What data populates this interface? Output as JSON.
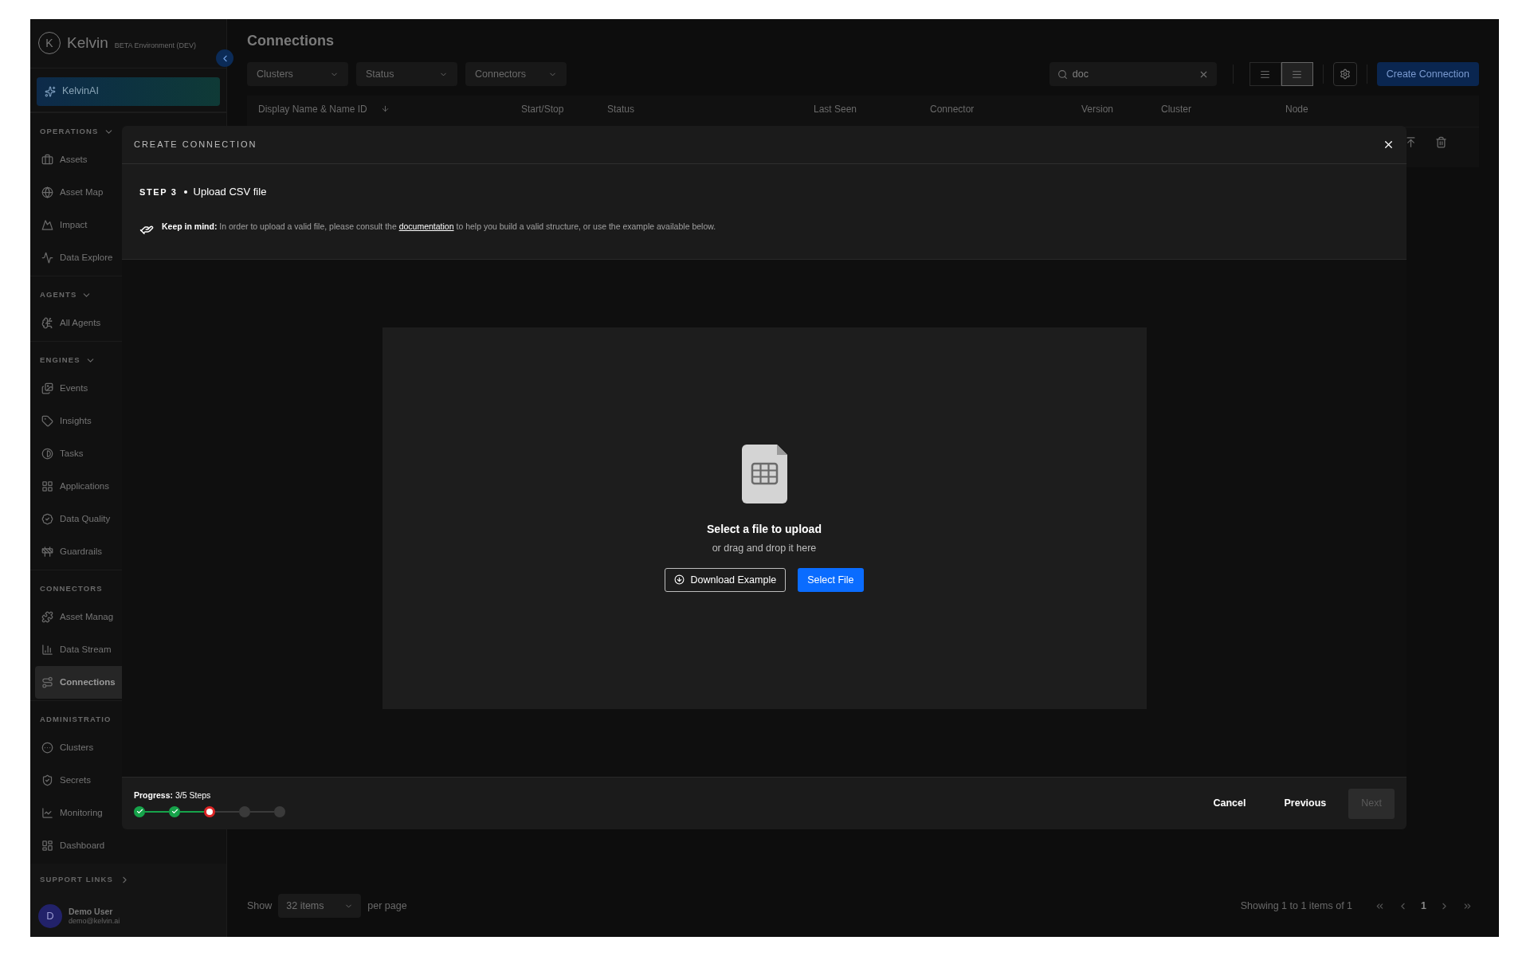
{
  "sidebar": {
    "logo_letter": "K",
    "brand": "Kelvin",
    "environment": "BETA Environment (DEV)",
    "ai_button": "KelvinAI",
    "sections": [
      {
        "title": "OPERATIONS",
        "expanded": true,
        "items": [
          {
            "label": "Assets",
            "selected": false
          },
          {
            "label": "Asset Map",
            "selected": false
          },
          {
            "label": "Impact",
            "selected": false
          },
          {
            "label": "Data Explore",
            "selected": false
          }
        ]
      },
      {
        "title": "AGENTS",
        "expanded": true,
        "items": [
          {
            "label": "All Agents",
            "selected": false
          }
        ]
      },
      {
        "title": "ENGINES",
        "expanded": true,
        "items": [
          {
            "label": "Events",
            "selected": false
          },
          {
            "label": "Insights",
            "selected": false
          },
          {
            "label": "Tasks",
            "selected": false
          },
          {
            "label": "Applications",
            "selected": false
          },
          {
            "label": "Data Quality",
            "selected": false
          },
          {
            "label": "Guardrails",
            "selected": false
          }
        ]
      },
      {
        "title": "CONNECTORS",
        "items": [
          {
            "label": "Asset Manag",
            "selected": false
          },
          {
            "label": "Data Stream",
            "selected": false
          },
          {
            "label": "Connections",
            "selected": true
          }
        ]
      },
      {
        "title": "ADMINISTRATIO",
        "items": [
          {
            "label": "Clusters",
            "selected": false
          },
          {
            "label": "Secrets",
            "selected": false
          },
          {
            "label": "Monitoring",
            "selected": false
          },
          {
            "label": "Dashboard",
            "selected": false
          }
        ]
      }
    ],
    "support_links": "SUPPORT LINKS",
    "user": {
      "initial": "D",
      "name": "Demo User",
      "email": "demo@kelvin.ai"
    }
  },
  "page_title": "Connections",
  "filters": [
    "Clusters",
    "Status",
    "Connectors"
  ],
  "search": {
    "value": "doc"
  },
  "view_modes": [
    {
      "selected": false
    },
    {
      "selected": true
    }
  ],
  "create_button": "Create Connection",
  "table": {
    "columns": [
      "Display Name & Name ID",
      "Start/Stop",
      "Status",
      "Last Seen",
      "Connector",
      "Version",
      "Cluster",
      "Node"
    ]
  },
  "pagination": {
    "show": "Show",
    "page_size": "32 items",
    "per_page": "per page",
    "summary": "Showing 1 to 1 items of 1",
    "page": "1"
  },
  "modal": {
    "title": "CREATE CONNECTION",
    "step": {
      "number": "STEP 3",
      "title": "Upload CSV file"
    },
    "note": {
      "lead": "Keep in mind:",
      "before": " In order to upload a valid file, please consult the ",
      "link": "documentation",
      "after": " to help you build a valid structure, or use the example available below."
    },
    "dropzone": {
      "title": "Select a file to upload",
      "subtitle": "or drag and drop it here",
      "download_button": "Download Example",
      "select_button": "Select File"
    },
    "progress": {
      "label": "Progress:",
      "value": "3/5 Steps",
      "steps": [
        {
          "kind": "done"
        },
        {
          "kind": "done"
        },
        {
          "kind": "current"
        },
        {
          "kind": "pending"
        },
        {
          "kind": "pending"
        }
      ]
    },
    "buttons": {
      "cancel": "Cancel",
      "previous": "Previous",
      "next": {
        "label": "Next",
        "disabled": true
      }
    }
  }
}
